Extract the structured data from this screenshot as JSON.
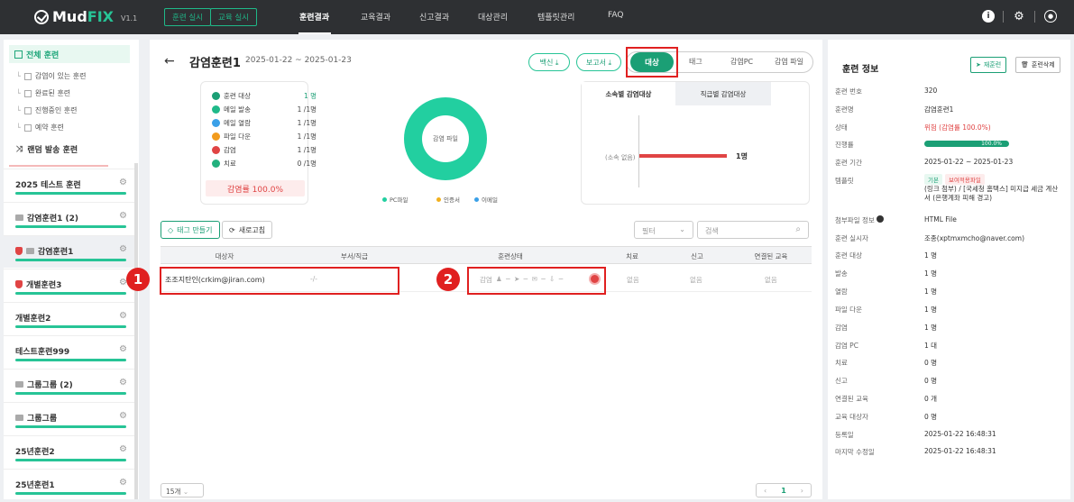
{
  "app": {
    "logo_name": "Mud",
    "logo_accent": "FIX",
    "version": "V1.1"
  },
  "topbar": {
    "buttons": [
      "훈련 실시",
      "교육 실시"
    ],
    "nav": [
      "훈련결과",
      "교육결과",
      "신고결과",
      "대상관리",
      "템플릿관리",
      "FAQ"
    ],
    "icons": [
      "info-icon",
      "gear-icon",
      "user-icon"
    ]
  },
  "sidebar": {
    "all_label": "전체 훈련",
    "sub_items": [
      "감염이 있는 훈련",
      "완료된 훈련",
      "진행중인 훈련",
      "예약 훈련"
    ],
    "random_label": "랜덤 발송 훈련",
    "groups": [
      {
        "label": "2025 테스트 훈련",
        "icon": ""
      },
      {
        "label": "감염훈련1 (2)",
        "icon": "folder"
      },
      {
        "label": "감염훈련1",
        "icon": "shield+folder"
      },
      {
        "label": "개별훈련3",
        "icon": "shield"
      },
      {
        "label": "개별훈련2",
        "icon": ""
      },
      {
        "label": "테스트훈련999",
        "icon": ""
      },
      {
        "label": "그룹그룹 (2)",
        "icon": "folder"
      },
      {
        "label": "그룹그룹",
        "icon": "folder"
      },
      {
        "label": "25년훈련2",
        "icon": ""
      },
      {
        "label": "25년훈련1",
        "icon": ""
      }
    ]
  },
  "main": {
    "title": "감염훈련1",
    "dates": "2025-01-22 ~ 2025-01-23",
    "pills": [
      "백신 ⤓",
      "보고서 ⤓"
    ],
    "segments": [
      "대상",
      "태그",
      "감염PC",
      "감염 파일"
    ],
    "stats": [
      {
        "label": "훈련 대상",
        "value": "1 명",
        "color": "#1b9f75"
      },
      {
        "label": "메일 발송",
        "value": "1 /1명",
        "color": "#1fb989"
      },
      {
        "label": "메일 열람",
        "value": "1 /1명",
        "color": "#3aa0e8"
      },
      {
        "label": "파일 다운",
        "value": "1 /1명",
        "color": "#f29b1d"
      },
      {
        "label": "감염",
        "value": "1 /1명",
        "color": "#e04444"
      },
      {
        "label": "치료",
        "value": "0 /1명",
        "color": "#22b07d"
      }
    ],
    "infection_rate": "감염률 100.0%",
    "donut_label": "감염 파일",
    "donut_legend": [
      "PC파일",
      "인증서",
      "이메일"
    ],
    "dept_tabs": [
      "소속별 감염대상",
      "직급별 감염대상"
    ],
    "bar_category": "(소속 없음)",
    "bar_value": "1명",
    "buttons": {
      "tag": "태그 만들기",
      "refresh": "새로고침"
    },
    "filter_placeholder": "필터",
    "search_placeholder": "검색",
    "table": {
      "headers": [
        "대상자",
        "부서/직급",
        "훈련상태",
        "치료",
        "신고",
        "연결된 교육"
      ],
      "rows": [
        {
          "target": "조조지탄인(crkim@jiran.com)",
          "dept": "-/-",
          "status": "감염",
          "cure": "없음",
          "report": "없음",
          "edu": "없음"
        }
      ]
    },
    "page_size": "15개",
    "page": "1",
    "annotations": [
      "1",
      "2"
    ]
  },
  "right": {
    "title": "훈련 정보",
    "buttons": [
      "재훈련",
      "훈련삭제"
    ],
    "rows": [
      {
        "label": "훈련 번호",
        "value": "320"
      },
      {
        "label": "훈련명",
        "value": "감염훈련1"
      },
      {
        "label": "상태",
        "value": "위험 (감염률 100.0%)"
      },
      {
        "label": "진행률",
        "value": "100.0%"
      },
      {
        "label": "훈련 기간",
        "value": "2025-01-22 ~ 2025-01-23"
      },
      {
        "label": "템플릿",
        "value": "(링크 첨부) / [국세청 홈택스] 미지급 세금 계산서 (은행계좌 피해 경고)"
      },
      {
        "label": "첨부파일 정보",
        "value": "HTML File"
      },
      {
        "label": "훈련 실시자",
        "value": "조종(xptmxmcho@naver.com)"
      },
      {
        "label": "훈련 대상",
        "value": "1 명"
      },
      {
        "label": "발송",
        "value": "1 명"
      },
      {
        "label": "열람",
        "value": "1 명"
      },
      {
        "label": "파일 다운",
        "value": "1 명"
      },
      {
        "label": "감염",
        "value": "1 명"
      },
      {
        "label": "감염 PC",
        "value": "1 대"
      },
      {
        "label": "치료",
        "value": "0 명"
      },
      {
        "label": "신고",
        "value": "0 명"
      },
      {
        "label": "연결된 교육",
        "value": "0 개"
      },
      {
        "label": "교육 대상자",
        "value": "0 명"
      },
      {
        "label": "등록일",
        "value": "2025-01-22 16:48:31"
      },
      {
        "label": "마지막 수정일",
        "value": "2025-01-22 16:48:31"
      }
    ],
    "template_tags": [
      "기본",
      "보여적용파일"
    ]
  },
  "colors": {
    "accent": "#1b9f75",
    "danger": "#e04444",
    "topbar": "#2e3033"
  }
}
